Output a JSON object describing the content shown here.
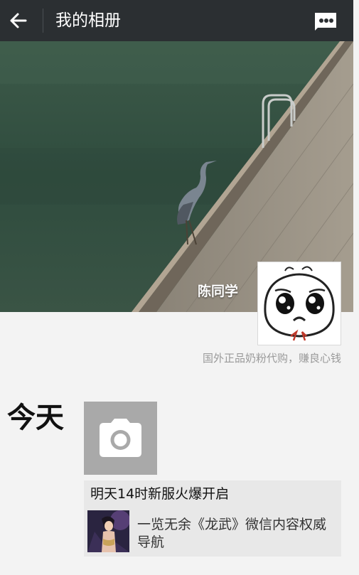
{
  "header": {
    "title": "我的相册",
    "back_icon": "arrow-left-icon",
    "more_icon": "more-icon"
  },
  "profile": {
    "name": "陈同学",
    "signature": "国外正品奶粉代购，赚良心钱"
  },
  "feed": {
    "section_label": "今天",
    "camera_icon": "camera-icon",
    "post": {
      "title": "明天14时新服火爆开启",
      "description": "一览无余《龙武》微信内容权威导航"
    }
  },
  "colors": {
    "topbar": "#2b2f32",
    "background": "#f3f3f3",
    "camera_tile": "#a9a9a9",
    "post_bg": "#e8e8e8"
  }
}
